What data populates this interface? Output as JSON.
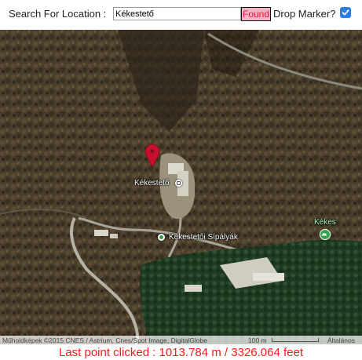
{
  "toolbar": {
    "search_label": "Search For Location :",
    "search_value": "Kékestető",
    "found_label": "Found",
    "drop_marker_label": "Drop Marker?",
    "drop_marker_checked": true
  },
  "map": {
    "labels": {
      "summit": "Kékestető",
      "ski_slope": "Kékestetői Sípályák",
      "peak": "Kékes"
    },
    "marker_color": "#c8102e"
  },
  "attribution": {
    "credit": "Műholdképek ©2015 CNES / Astrium, Cnes/Spot Image, DigitalGlobe",
    "scale": "100 m",
    "map_type": "Általános"
  },
  "status": {
    "text": "Last point clicked : 1013.784 m / 3326.064 feet"
  }
}
